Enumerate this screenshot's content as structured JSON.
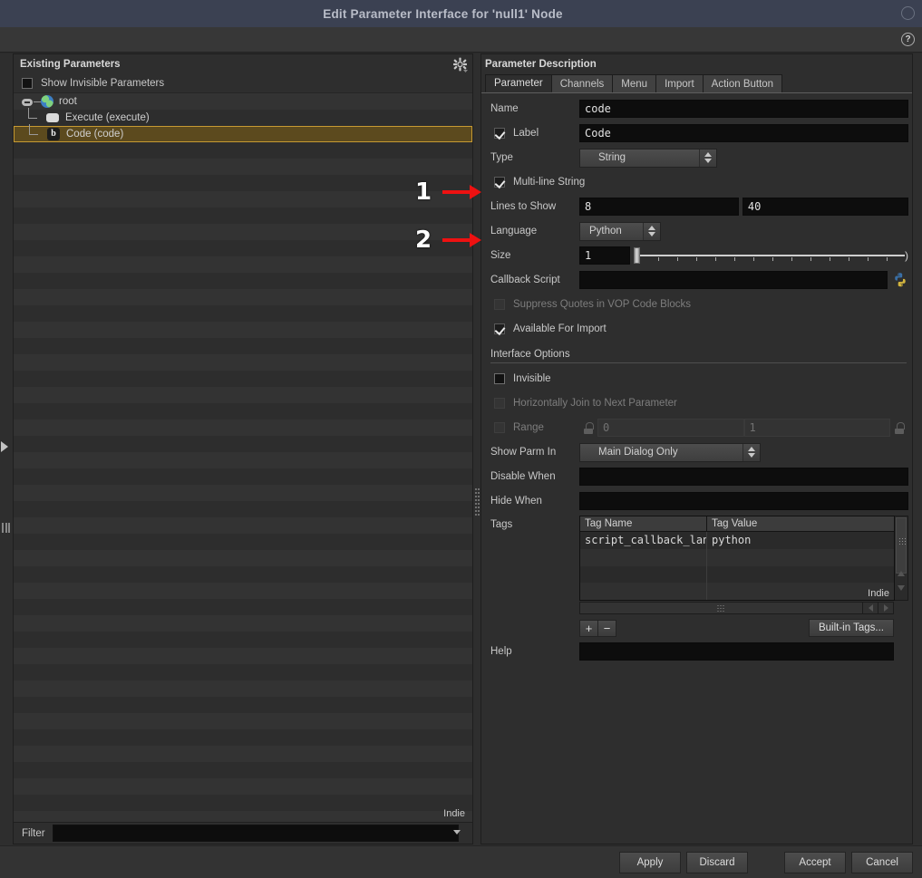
{
  "window": {
    "title": "Edit Parameter Interface for 'null1' Node",
    "help_icon": "question-icon",
    "minimize_icon": "circle-icon"
  },
  "left_panel": {
    "title": "Existing Parameters",
    "gear_icon": "gear-icon",
    "show_invisible_label": "Show Invisible Parameters",
    "show_invisible_checked": false,
    "tree": [
      {
        "label": "root",
        "icon": "globe-icon",
        "depth": 0,
        "selected": false,
        "expanded": true
      },
      {
        "label": "Execute (execute)",
        "icon": "button-icon",
        "depth": 1,
        "selected": false
      },
      {
        "label": "Code (code)",
        "icon": "b-icon",
        "depth": 1,
        "selected": true
      }
    ],
    "watermark": "Indie",
    "filter_label": "Filter",
    "filter_value": "",
    "filter_dropdown_icon": "chevron-down-icon"
  },
  "right_panel": {
    "title": "Parameter Description",
    "tabs": [
      {
        "label": "Parameter",
        "active": true
      },
      {
        "label": "Channels",
        "active": false
      },
      {
        "label": "Menu",
        "active": false
      },
      {
        "label": "Import",
        "active": false
      },
      {
        "label": "Action Button",
        "active": false
      }
    ],
    "fields": {
      "name_label": "Name",
      "name_value": "code",
      "label_label": "Label",
      "label_checked": true,
      "label_value": "Code",
      "type_label": "Type",
      "type_value": "String",
      "multiline_label": "Multi-line String",
      "multiline_checked": true,
      "lines_label": "Lines to Show",
      "lines_value": "8",
      "lines_value2": "40",
      "language_label": "Language",
      "language_value": "Python",
      "size_label": "Size",
      "size_value": "1",
      "callback_label": "Callback Script",
      "callback_value": "",
      "callback_icon": "python-icon",
      "suppress_quotes_label": "Suppress Quotes in VOP Code Blocks",
      "suppress_quotes_checked": false,
      "suppress_quotes_disabled": true,
      "available_import_label": "Available For Import",
      "available_import_checked": true
    },
    "interface_options": {
      "section_title": "Interface Options",
      "invisible_label": "Invisible",
      "invisible_checked": false,
      "hjoin_label": "Horizontally Join to Next Parameter",
      "hjoin_checked": false,
      "hjoin_disabled": true,
      "range_label": "Range",
      "range_checked": false,
      "range_disabled": true,
      "range_min": "0",
      "range_max": "1",
      "lock_icon": "lock-icon",
      "show_parm_in_label": "Show Parm In",
      "show_parm_in_value": "Main Dialog Only",
      "disable_when_label": "Disable When",
      "disable_when_value": "",
      "hide_when_label": "Hide When",
      "hide_when_value": ""
    },
    "tags": {
      "label": "Tags",
      "columns": [
        "Tag Name",
        "Tag Value"
      ],
      "rows": [
        {
          "name": "script_callback_language",
          "value": "python"
        },
        {
          "name": "",
          "value": ""
        },
        {
          "name": "",
          "value": ""
        },
        {
          "name": "",
          "value": ""
        }
      ],
      "watermark": "Indie",
      "add_button": "+",
      "remove_button": "−",
      "builtin_button": "Built-in Tags...",
      "scroll_left_icon": "arrow-left-icon",
      "scroll_right_icon": "arrow-right-icon"
    },
    "help": {
      "label": "Help",
      "value": ""
    }
  },
  "footer": {
    "buttons": [
      "Apply",
      "Discard",
      "Accept",
      "Cancel"
    ]
  },
  "annotations": [
    {
      "number": "1",
      "target": "multiline-checkbox"
    },
    {
      "number": "2",
      "target": "language-label"
    }
  ],
  "colors": {
    "titlebar": "#3b4152",
    "selection": "#5c4a1e",
    "selection_border": "#c79a32",
    "annotation_red": "#ee1111",
    "panel_bg": "#2e2e2e",
    "input_bg": "#0d0d0d"
  }
}
